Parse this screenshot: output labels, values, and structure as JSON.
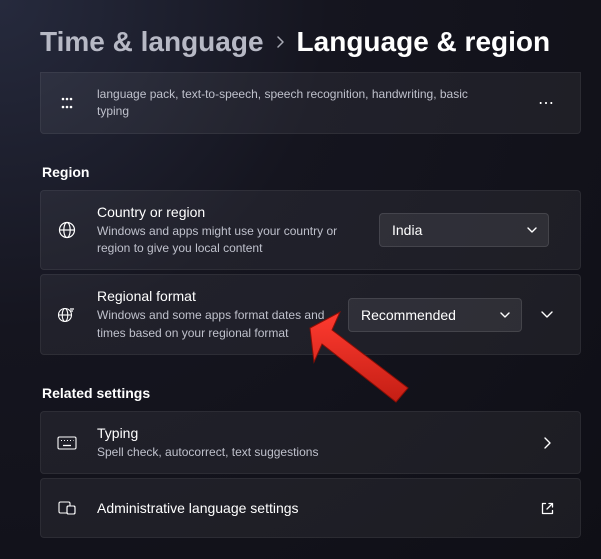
{
  "breadcrumb": {
    "parent": "Time & language",
    "current": "Language & region"
  },
  "language_card": {
    "subtitle": "language pack, text-to-speech, speech recognition, handwriting, basic typing"
  },
  "sections": {
    "region": "Region",
    "related": "Related settings"
  },
  "region": {
    "country": {
      "title": "Country or region",
      "subtitle": "Windows and apps might use your country or region to give you local content",
      "value": "India"
    },
    "format": {
      "title": "Regional format",
      "subtitle": "Windows and some apps format dates and times based on your regional format",
      "value": "Recommended"
    }
  },
  "related": {
    "typing": {
      "title": "Typing",
      "subtitle": "Spell check, autocorrect, text suggestions"
    },
    "admin": {
      "title": "Administrative language settings"
    }
  }
}
